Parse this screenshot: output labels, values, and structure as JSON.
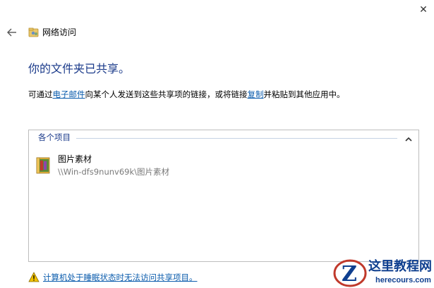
{
  "window": {
    "title": "网络访问",
    "close_glyph": "✕"
  },
  "main": {
    "heading": "你的文件夹已共享。",
    "description": {
      "prefix": "可通过",
      "email_link": "电子邮件",
      "middle": "向某个人发送到这些共享项的链接，或将链接",
      "copy_link": "复制",
      "suffix": "并粘贴到其他应用中。"
    }
  },
  "items_panel": {
    "group_label": "各个项目",
    "items": [
      {
        "name": "图片素材",
        "path": "\\\\Win-dfs9nunv69k\\图片素材"
      }
    ]
  },
  "footer": {
    "warning_link": "计算机处于睡眠状态时无法访问共享项目。"
  },
  "watermark": {
    "text": "这里教程网",
    "url": "herecours.com"
  },
  "colors": {
    "heading": "#1a3a8a",
    "link": "#0b5cad",
    "warning": "#f2c200",
    "watermark": "#0f3f8f"
  }
}
